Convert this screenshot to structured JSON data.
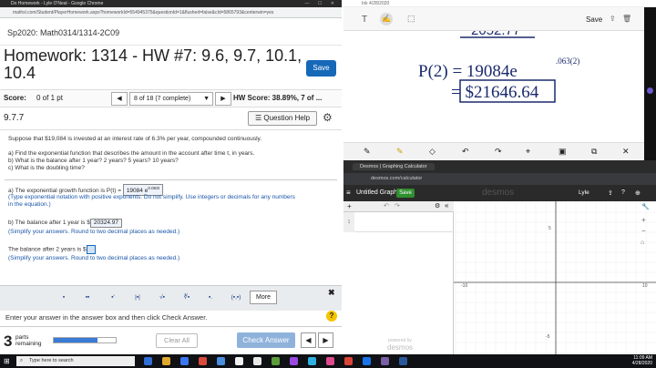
{
  "chrome": {
    "window_title": "Do Homework - Lyle O'Neal - Google Chrome",
    "url": "mathxl.com/Student/PlayerHomework.aspx?homeworkId=554945375&questionId=1&flushed=false&cId=5865793&centerwin=yes"
  },
  "course": {
    "name": "Sp2020: Math0314/1314-2C09"
  },
  "homework": {
    "title": "Homework: 1314 - HW #7: 9.6, 9.7, 10.1, 10.4",
    "save_label": "Save"
  },
  "score": {
    "label": "Score:",
    "value": "0 of 1 pt",
    "question_select": "8 of 18 (7 complete)",
    "hw_score": "HW Score: 38.89%, 7 of ..."
  },
  "question": {
    "number": "9.7.7",
    "help_label": "Question Help",
    "intro": "Suppose that $19,084 is invested at an interest rate of 6.3% per year, compounded continuously.",
    "a_text": "a) Find the exponential function that describes the amount in the account after time t, in years.",
    "b_text": "b) What is the balance after 1 year? 2 years? 5 years? 10 years?",
    "c_text": "c) What is the doubling time?",
    "ans_a_prefix": "a) The exponential growth function is P(t) =",
    "ans_a_value": "19084",
    "ans_a_e": "e",
    "ans_a_exp": "0.063t",
    "ans_a_hint": "(Type exponential notation with positive exponents. Do not simplify. Use integers or decimals for any numbers",
    "ans_a_hint2": "in the equation.)",
    "ans_b_prefix": "b) The balance after 1 year is $",
    "ans_b_value": "20324.97",
    "ans_b_hint": "(Simplify your answers. Round to two decimal places as needed.)",
    "ans_b2_prefix": "The balance after 2 years is $",
    "ans_b2_hint": "(Simplify your answers. Round to two decimal places as needed.)"
  },
  "palette": {
    "buttons": [
      "▪",
      "▪▪",
      "▪'",
      "|▪|",
      "√▪",
      "∛▪",
      "▪.",
      "(▪,▪)"
    ],
    "more_label": "More",
    "close": "✖"
  },
  "footer": {
    "enter_msg": "Enter your answer in the answer box and then click Check Answer.",
    "help": "?",
    "parts_num": "3",
    "parts_label1": "parts",
    "parts_label2": "remaining",
    "progress_fraction": 0.7,
    "clear_label": "Clear All",
    "check_label": "Check Answer"
  },
  "taskbar": {
    "search_placeholder": "Type here to search",
    "time": "11:09 AM",
    "date": "4/28/2020"
  },
  "whiteboard": {
    "title": "Ink 4/28/2020",
    "save_label": "Save",
    "top_line": "2052.77",
    "eq_left": "P(2) = 19084e",
    "eq_exp": ".063(2)",
    "eq_result": "= $21646.64"
  },
  "desmos": {
    "tab_title": "Desmos | Graphing Calculator",
    "url": "desmos.com/calculator",
    "graph_title": "Untitled Graph",
    "save_label": "Save",
    "logo": "desmos",
    "user": "Lyle",
    "expr_index": "1",
    "y_top": "5",
    "y_bottom": "-5",
    "x_left": "-10",
    "x_right": "10",
    "powered_by": "powered by",
    "powered_logo": "desmos"
  },
  "colors": {
    "accent": "#1669b8",
    "check": "#8fb2db",
    "desmos_save": "#2f8f2f"
  }
}
